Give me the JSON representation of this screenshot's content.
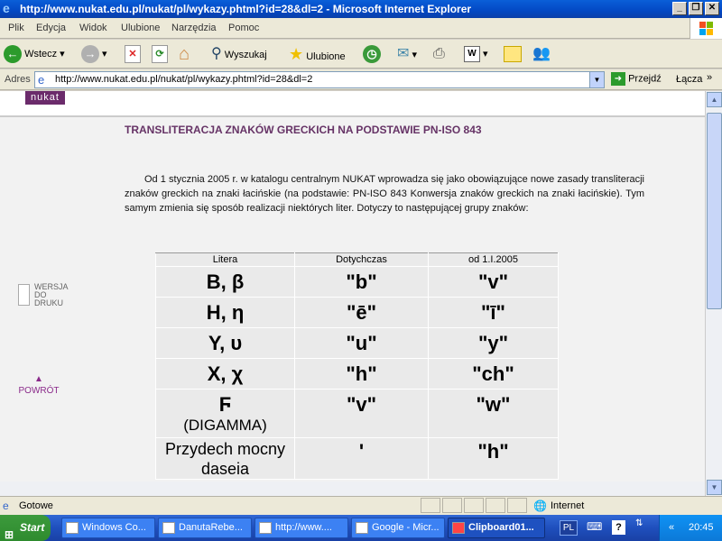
{
  "window": {
    "title": "http://www.nukat.edu.pl/nukat/pl/wykazy.phtml?id=28&dl=2 - Microsoft Internet Explorer"
  },
  "menu": [
    "Plik",
    "Edycja",
    "Widok",
    "Ulubione",
    "Narzędzia",
    "Pomoc"
  ],
  "toolbar": {
    "back": "Wstecz",
    "search": "Wyszukaj",
    "favorites": "Ulubione"
  },
  "address": {
    "label": "Adres",
    "url": "http://www.nukat.edu.pl/nukat/pl/wykazy.phtml?id=28&dl=2",
    "go": "Przejdź",
    "links": "Łącza"
  },
  "page": {
    "logo": "nukat",
    "title": "TRANSLITERACJA ZNAKÓW GRECKICH NA PODSTAWIE PN-ISO 843",
    "intro": "Od 1 stycznia 2005 r. w katalogu centralnym NUKAT wprowadza się jako obowiązujące nowe zasady transliteracji znaków greckich na znaki łacińskie (na podstawie: PN-ISO 843 Konwersja znaków greckich na znaki łacińskie). Tym samym zmienia się sposób realizacji niektórych liter. Dotyczy to następującej grupy znaków:",
    "print_link": "WERSJA DO DRUKU",
    "back_link": "POWRÓT",
    "table": {
      "headers": [
        "Litera",
        "Dotychczas",
        "od 1.I.2005"
      ],
      "rows": [
        {
          "letter": "Β, β",
          "sub": "",
          "old": "\"b\"",
          "new": "\"v\""
        },
        {
          "letter": "Η, η",
          "sub": "",
          "old": "\"ē\"",
          "new": "\"ī\""
        },
        {
          "letter": "Υ, υ",
          "sub": "",
          "old": "\"u\"",
          "new": "\"y\""
        },
        {
          "letter": "Χ, χ",
          "sub": "",
          "old": "\"h\"",
          "new": "\"ch\""
        },
        {
          "letter": "Ϝ",
          "sub": "(DIGAMMA)",
          "old": "\"v\"",
          "new": "\"w\""
        },
        {
          "letter": "Przydech mocny daseia",
          "sub": "",
          "old": "'",
          "new": "\"h\""
        }
      ]
    }
  },
  "status": {
    "left": "Gotowe",
    "zone": "Internet"
  },
  "taskbar": {
    "start": "Start",
    "buttons": [
      "Windows Co...",
      "DanutaRebe...",
      "http://www....",
      "Google - Micr...",
      "Clipboard01..."
    ],
    "lang": "PL",
    "time": "20:45"
  }
}
